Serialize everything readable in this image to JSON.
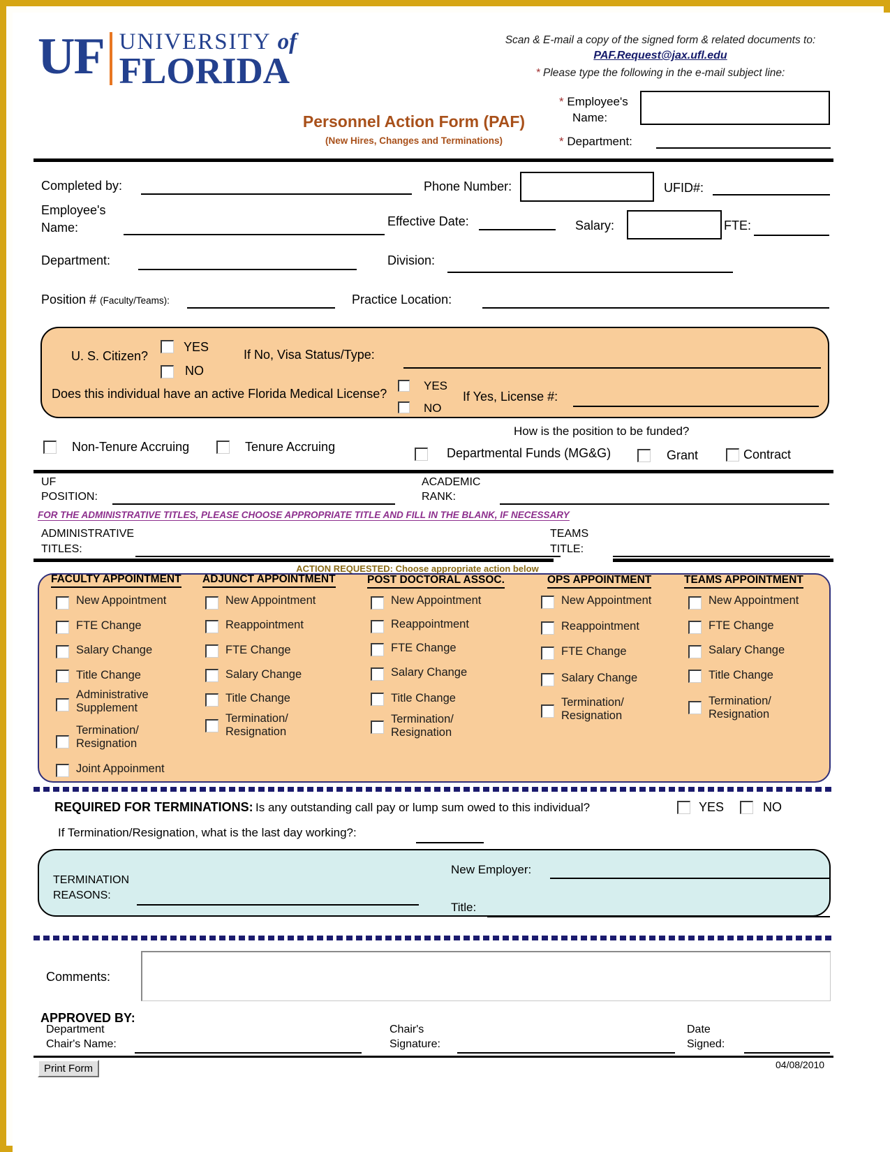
{
  "brand": {
    "logo_mark": "UF",
    "logo_university": "UNIVERSITY",
    "logo_of": "of",
    "logo_florida": "FLORIDA",
    "blue": "#23408e",
    "orange_accent": "#e87722",
    "panel_orange": "#f9cd9a",
    "panel_teal": "#d6eeee",
    "title_color": "#a8501a",
    "border_gold": "#d6a514"
  },
  "header": {
    "scan_line1": "Scan & E-mail a copy of the signed form & related documents to:",
    "email": "PAF.Request@jax.ufl.edu",
    "subject_note": "Please type the following in the e-mail subject line:",
    "title": "Personnel Action Form (PAF)",
    "subtitle": "(New Hires, Changes and Terminations)",
    "employee_name_label": "Employee's Name:",
    "employee_name_value": "",
    "department_label": "Department:",
    "department_value": ""
  },
  "info": {
    "completed_by_label": "Completed by:",
    "completed_by_value": "",
    "phone_label": "Phone Number:",
    "phone_value": "",
    "ufid_label": "UFID#:",
    "ufid_value": "",
    "employee_name_label": "Employee's Name:",
    "employee_name_value": "",
    "effective_date_label": "Effective Date:",
    "effective_date_value": "",
    "salary_label": "Salary:",
    "salary_value": "",
    "fte_label": "FTE:",
    "fte_value": "",
    "department_label": "Department:",
    "department_value": "",
    "division_label": "Division:",
    "division_value": "",
    "position_label": "Position #",
    "position_label_small": "(Faculty/Teams):",
    "position_value": "",
    "practice_location_label": "Practice Location:",
    "practice_location_value": ""
  },
  "citizen": {
    "question": "U. S. Citizen?",
    "yes": "YES",
    "no": "NO",
    "visa_label": "If No, Visa Status/Type:",
    "visa_value": "",
    "license_question": "Does this individual have an active Florida Medical License?",
    "license_yes": "YES",
    "license_no": "NO",
    "license_num_label": "If Yes, License #:",
    "license_num_value": ""
  },
  "tenure": {
    "non_tenure": "Non-Tenure Accruing",
    "tenure": "Tenure Accruing",
    "funding_question": "How is the position to be funded?",
    "departmental": "Departmental Funds (MG&G)",
    "grant": "Grant",
    "contract": "Contract"
  },
  "position_block": {
    "uf_position_label_l1": "UF",
    "uf_position_label_l2": "POSITION:",
    "uf_position_value": "",
    "academic_rank_label_l1": "ACADEMIC",
    "academic_rank_label_l2": "RANK:",
    "academic_rank_value": "",
    "admin_note": "FOR THE ADMINISTRATIVE TITLES, PLEASE CHOOSE APPROPRIATE TITLE AND FILL IN THE BLANK, IF NECESSARY",
    "admin_titles_label_l1": "ADMINISTRATIVE",
    "admin_titles_label_l2": "TITLES:",
    "admin_titles_value": "",
    "teams_title_label_l1": "TEAMS",
    "teams_title_label_l2": "TITLE:",
    "teams_title_value": ""
  },
  "action": {
    "banner": "ACTION REQUESTED:  Choose  appropriate action below",
    "columns": [
      {
        "header": "FACULTY APPOINTMENT",
        "options": [
          "New Appointment",
          "FTE Change",
          "Salary Change",
          "Title Change",
          "Administrative Supplement",
          "Termination/ Resignation",
          "Joint Appoinment"
        ]
      },
      {
        "header": "ADJUNCT  APPOINTMENT",
        "options": [
          "New Appointment",
          "Reappointment",
          "FTE Change",
          "Salary Change",
          "Title Change",
          "Termination/ Resignation"
        ]
      },
      {
        "header": "POST DOCTORAL ASSOC.",
        "options": [
          "New Appointment",
          "Reappointment",
          "FTE Change",
          "Salary Change",
          "Title Change",
          "Termination/ Resignation"
        ]
      },
      {
        "header": "OPS  APPOINTMENT",
        "options": [
          "New Appointment",
          "Reappointment",
          "FTE Change",
          "Salary Change",
          "Termination/ Resignation"
        ]
      },
      {
        "header": "TEAMS APPOINTMENT",
        "options": [
          "New Appointment",
          "FTE Change",
          "Salary Change",
          "Title Change",
          "Termination/ Resignation"
        ]
      }
    ]
  },
  "terminations": {
    "required_label": "REQUIRED FOR TERMINATIONS:",
    "question": "Is any outstanding call pay or lump sum owed to this individual?",
    "yes": "YES",
    "no": "NO",
    "last_day_label": "If Termination/Resignation, what is the last day working?:",
    "last_day_value": "",
    "reasons_label_l1": "TERMINATION",
    "reasons_label_l2": "REASONS:",
    "reasons_value": "",
    "new_employer_label": "New Employer:",
    "new_employer_value": "",
    "title_label": "Title:",
    "title_value": ""
  },
  "footer": {
    "comments_label": "Comments:",
    "comments_value": "",
    "approved_by": "APPROVED BY:",
    "dept_chair_name_l1": "Department",
    "dept_chair_name_l2": "Chair's Name:",
    "dept_chair_name_value": "",
    "chair_sig_l1": "Chair's",
    "chair_sig_l2": "Signature:",
    "chair_sig_value": "",
    "date_signed_l1": "Date",
    "date_signed_l2": "Signed:",
    "date_signed_value": "",
    "print_button": "Print Form",
    "revision_date": "04/08/2010"
  }
}
